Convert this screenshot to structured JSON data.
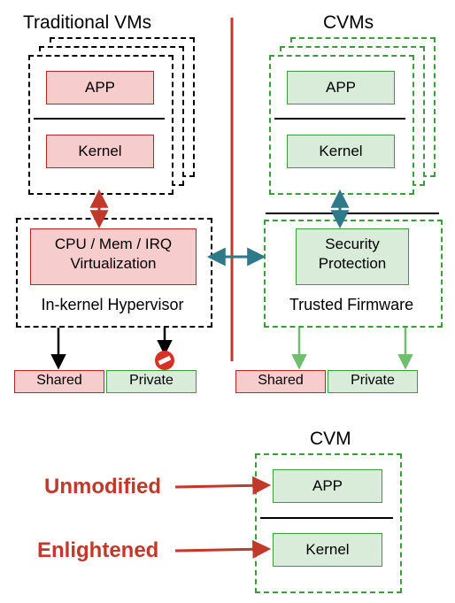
{
  "titles": {
    "traditional": "Traditional VMs",
    "cvms": "CVMs",
    "cvm_single": "CVM"
  },
  "left": {
    "app": "APP",
    "kernel": "Kernel",
    "virt_line1": "CPU / Mem / IRQ",
    "virt_line2": "Virtualization",
    "hypervisor": "In-kernel Hypervisor"
  },
  "right": {
    "app": "APP",
    "kernel": "Kernel",
    "sec_line1": "Security",
    "sec_line2": "Protection",
    "firmware": "Trusted Firmware"
  },
  "memory": {
    "shared": "Shared",
    "private": "Private"
  },
  "bottom": {
    "unmodified": "Unmodified",
    "enlightened": "Enlightened",
    "app": "APP",
    "kernel": "Kernel"
  },
  "colors": {
    "red_fill": "#f7cccc",
    "red_border": "#b22828",
    "green_fill": "#d9ecd9",
    "green_border": "#3b9c3b",
    "teal": "#2f7a8a",
    "red_text": "#c0392b"
  }
}
